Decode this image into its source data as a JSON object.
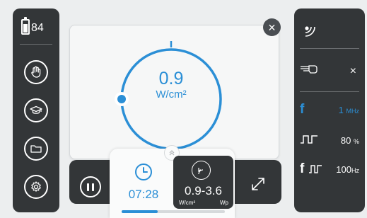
{
  "battery": {
    "level": "84",
    "fill_fraction": 0.84
  },
  "left_nav": [
    {
      "name": "hand-icon"
    },
    {
      "name": "graduation-cap-icon"
    },
    {
      "name": "folder-icon"
    },
    {
      "name": "settings-gear-icon"
    }
  ],
  "dial": {
    "value": "0.9",
    "unit": "W/cm²",
    "position_fraction": 0.75,
    "accent": "#2b8fd6"
  },
  "timer": {
    "time": "07:28",
    "progress": 0.35
  },
  "intensity": {
    "range": "0.9-3.6",
    "unit_left": "W/cm²",
    "unit_right": "Wp"
  },
  "right_panel": {
    "frequency": {
      "label": "f",
      "value": "1",
      "unit": "MHz"
    },
    "duty_cycle": {
      "value": "80",
      "unit": "%"
    },
    "pulse_frequency": {
      "label": "f",
      "value": "100",
      "unit": "Hz"
    },
    "applicator_close": "×"
  },
  "colors": {
    "accent": "#2b8fd6",
    "panel": "#333638",
    "background": "#eceeef"
  }
}
